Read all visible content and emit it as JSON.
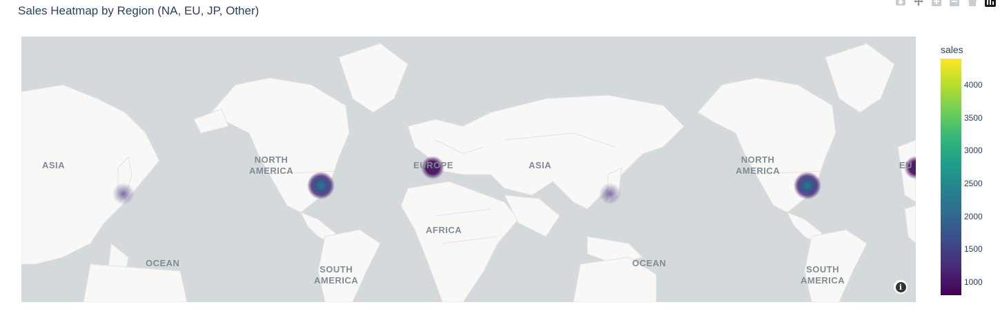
{
  "title": "Sales Heatmap by Region (NA, EU, JP, Other)",
  "modebar": [
    "camera-icon",
    "pan-icon",
    "zoom-in-icon",
    "zoom-out-icon",
    "home-icon",
    "plotly-logo-icon"
  ],
  "map": {
    "labels": {
      "asia_left": "ASIA",
      "north_america_left": "NORTH\nAMERICA",
      "europe": "EUROPE",
      "asia_right": "ASIA",
      "north_america_right": "NORTH\nAMERICA",
      "europe_edge": "EU",
      "africa": "AFRICA",
      "ocean_left": "OCEAN",
      "ocean_right": "OCEAN",
      "south_america_left": "SOUTH\nAMERICA",
      "south_america_right": "SOUTH\nAMERICA"
    },
    "land_color": "#f8f8f6",
    "water_color": "#d4dadc",
    "info_icon": "i"
  },
  "chart_data": {
    "type": "heatmap",
    "colorscale": "viridis",
    "colorbar": {
      "title": "sales",
      "ticks": [
        "1000",
        "1500",
        "2000",
        "2500",
        "3000",
        "3500",
        "4000"
      ],
      "range": [
        800,
        4400
      ]
    },
    "points": [
      {
        "region": "NA",
        "lat": 40,
        "lon": -75,
        "value": 2300
      },
      {
        "region": "EU",
        "lat": 50,
        "lon": 10,
        "value": 1100
      },
      {
        "region": "JP",
        "lat": 36,
        "lon": 138,
        "value": 900
      }
    ]
  }
}
